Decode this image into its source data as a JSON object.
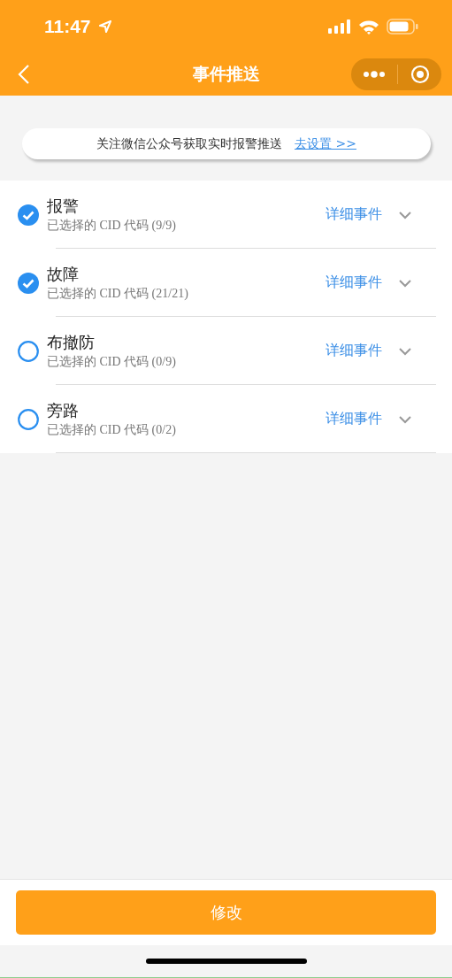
{
  "status_bar": {
    "time": "11:47"
  },
  "nav": {
    "title": "事件推送"
  },
  "banner": {
    "text": "关注微信公众号获取实时报警推送",
    "link": "去设置 >>"
  },
  "events": [
    {
      "title": "报警",
      "subtitle": "已选择的 CID 代码 (9/9)",
      "checked": true,
      "detail": "详细事件",
      "expanded": false
    },
    {
      "title": "故障",
      "subtitle": "已选择的 CID 代码 (21/21)",
      "checked": true,
      "detail": "详细事件",
      "expanded": false
    },
    {
      "title": "布撤防",
      "subtitle": "已选择的 CID 代码 (0/9)",
      "checked": false,
      "detail": "详细事件",
      "expanded": false
    },
    {
      "title": "旁路",
      "subtitle": "已选择的 CID 代码 (0/2)",
      "checked": false,
      "detail": "详细事件",
      "expanded": false
    }
  ],
  "button": {
    "label": "修改"
  }
}
